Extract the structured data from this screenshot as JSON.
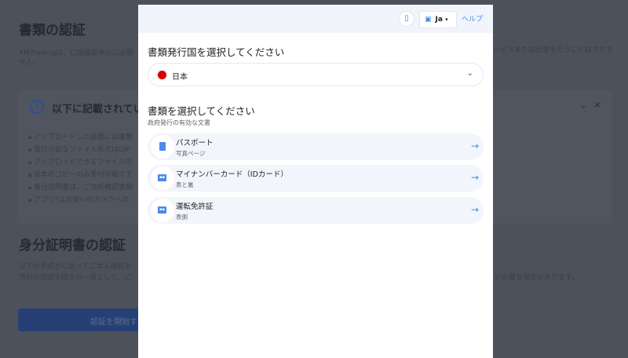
{
  "background": {
    "title": "書類の認証",
    "intro_left": "XMTradingは、口座開設申込に必要",
    "intro_left_2": "せん。",
    "intro_right": "ービスまたは出金を行うことはできま",
    "notice": {
      "title": "以下に記載されてい",
      "items": [
        "アップロードした画像には書類",
        "受付可能なファイル形式はGIF",
        "アップロードできるファイルの",
        "原本のコピーのみ受付可能です",
        "身分証明書は、ご住所確認書類",
        "アプリ*はお使いのカメラへの"
      ],
      "collapse_icon": "chevron-down-icon",
      "close_icon": "close-icon"
    },
    "id_title": "身分証明書の認証",
    "id_text_1": "以下の手続きに従ってご本人確認を",
    "id_text_2": "当社の認証手続きの一環として、ご",
    "id_text_right": "が必要な場合があります。",
    "start_button": "認証を開始す"
  },
  "modal": {
    "header": {
      "phone_icon": "mobile-phone-icon",
      "language": "Ja",
      "help": "ヘルプ"
    },
    "country_title": "書類発行国を選択してください",
    "country": {
      "value": "日本",
      "flag": "japan-flag",
      "flag_color": "#d90000"
    },
    "doc_title": "書類を選択してください",
    "doc_subtitle": "政府発行の有効な文書",
    "documents": [
      {
        "title": "パスポート",
        "subtitle": "写真ページ",
        "icon": "passport-icon"
      },
      {
        "title": "マイナンバーカード（IDカード）",
        "subtitle": "表と裏",
        "icon": "id-card-icon"
      },
      {
        "title": "運転免許証",
        "subtitle": "表側",
        "icon": "driver-license-icon"
      }
    ],
    "accent": "#4a8ae8"
  }
}
